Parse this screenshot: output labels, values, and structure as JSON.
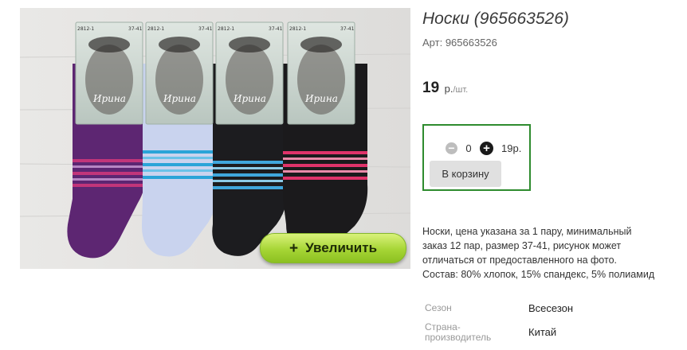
{
  "product": {
    "title": "Носки (965663526)",
    "sku_label": "Арт:",
    "sku_value": "965663526",
    "price": {
      "value": "19",
      "currency": "р.",
      "unit": "/шт."
    },
    "image": {
      "sock_tags": [
        {
          "code": "2812-1",
          "size": "37-41",
          "brand": "Ирина"
        },
        {
          "code": "2812-1",
          "size": "37-41",
          "brand": "Ирина"
        },
        {
          "code": "2812-1",
          "size": "37-41",
          "brand": "Ирина"
        },
        {
          "code": "2812-1",
          "size": "37-41",
          "brand": "Ирина"
        }
      ],
      "zoom_label": "Увеличить",
      "zoom_icon": "plus-icon"
    }
  },
  "cart": {
    "quantity": "0",
    "sum": "19р.",
    "add_label": "В корзину",
    "minus_icon": "minus-icon",
    "plus_icon": "plus-circle-icon",
    "accent_color": "#2e8b2e"
  },
  "description": {
    "lines": [
      "Носки, цена указана за 1 пару, минимальный",
      "заказ 12 пар, размер 37-41, рисунок может",
      "отличаться от предоставленного на фото.",
      "Состав: 80% хлопок, 15% спандекс, 5% полиамид"
    ]
  },
  "properties": [
    {
      "label_lines": [
        "Сезон"
      ],
      "value": "Всесезон"
    },
    {
      "label_lines": [
        "Страна-",
        "производитель"
      ],
      "value": "Китай"
    }
  ]
}
